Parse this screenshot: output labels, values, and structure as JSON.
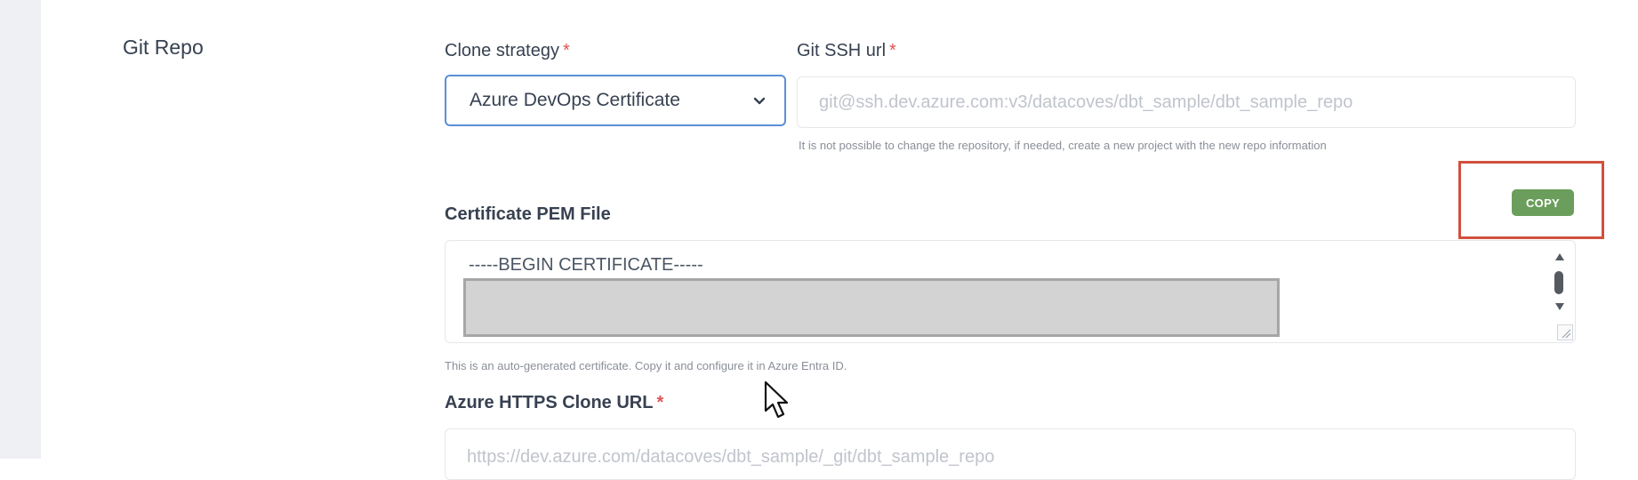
{
  "section": {
    "title": "Git Repo"
  },
  "clone_strategy": {
    "label": "Clone strategy",
    "required_mark": "*",
    "value": "Azure DevOps Certificate"
  },
  "git_ssh_url": {
    "label": "Git SSH url",
    "required_mark": "*",
    "placeholder": "git@ssh.dev.azure.com:v3/datacoves/dbt_sample/dbt_sample_repo",
    "help": "It is not possible to change the repository, if needed, create a new project with the new repo information"
  },
  "certificate": {
    "label": "Certificate PEM File",
    "copy_label": "COPY",
    "first_line": "-----BEGIN CERTIFICATE-----",
    "help": "This is an auto-generated certificate. Copy it and configure it in Azure Entra ID."
  },
  "https_url": {
    "label": "Azure HTTPS Clone URL",
    "required_mark": "*",
    "placeholder": "https://dev.azure.com/datacoves/dbt_sample/_git/dbt_sample_repo"
  },
  "icons": {
    "dropdown": "chevron-down-icon",
    "cursor": "mouse-pointer-icon",
    "scroll_up": "triangle-up-icon",
    "scroll_down": "triangle-down-icon",
    "resize": "resize-grip-icon"
  },
  "colors": {
    "accent_border": "#5b8fd6",
    "copy_button": "#6b9e5c",
    "highlight": "#d0513d",
    "required": "#e05252"
  }
}
